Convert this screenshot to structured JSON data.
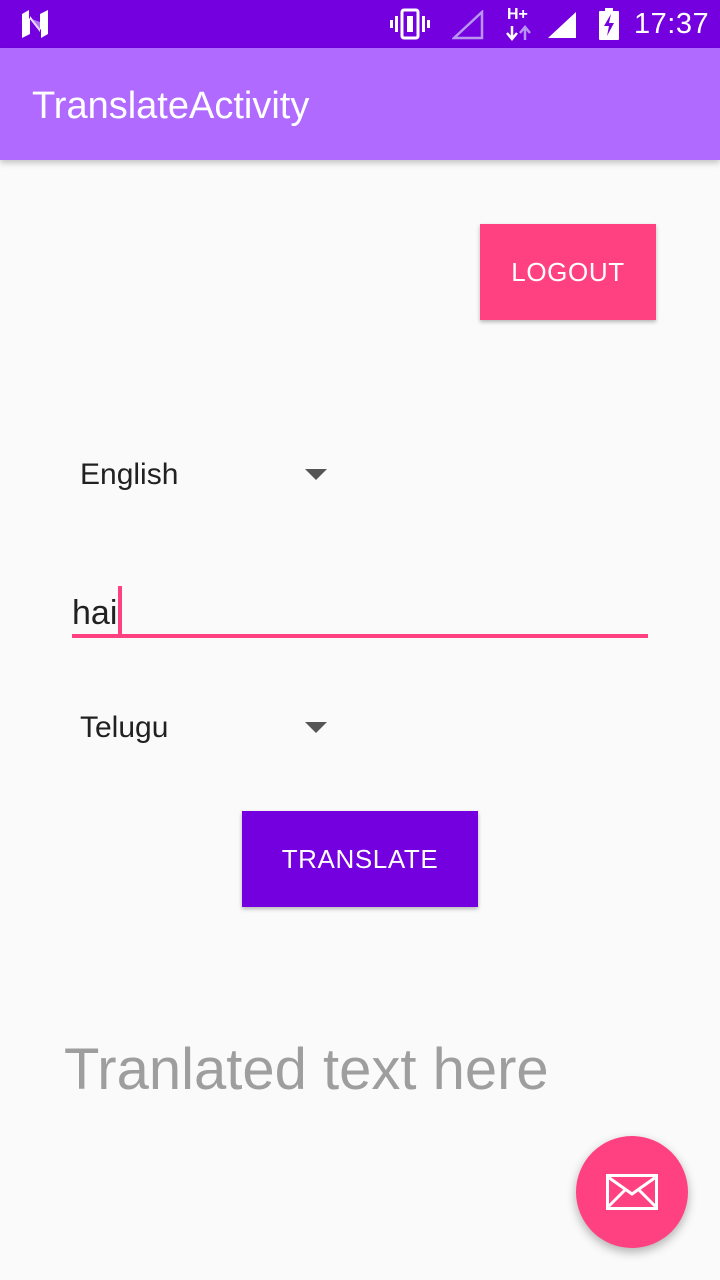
{
  "status_bar": {
    "time": "17:37",
    "icons": [
      "android-n-logo",
      "vibrate-icon",
      "signal-empty-icon",
      "hplus-data-icon",
      "signal-full-icon",
      "battery-charging-icon"
    ]
  },
  "app_bar": {
    "title": "TranslateActivity"
  },
  "actions": {
    "logout_label": "LOGOUT",
    "translate_label": "TRANSLATE"
  },
  "source_language": {
    "selected": "English"
  },
  "input": {
    "value": "hai"
  },
  "target_language": {
    "selected": "Telugu"
  },
  "output": {
    "placeholder": "Tranlated text here"
  },
  "fab": {
    "icon": "mail-icon"
  },
  "colors": {
    "status_bar": "#7400e0",
    "app_bar": "#b06aff",
    "accent": "#ff4081",
    "primary_button": "#7400e0",
    "hint_text": "#9e9e9e",
    "background": "#fafafa"
  }
}
